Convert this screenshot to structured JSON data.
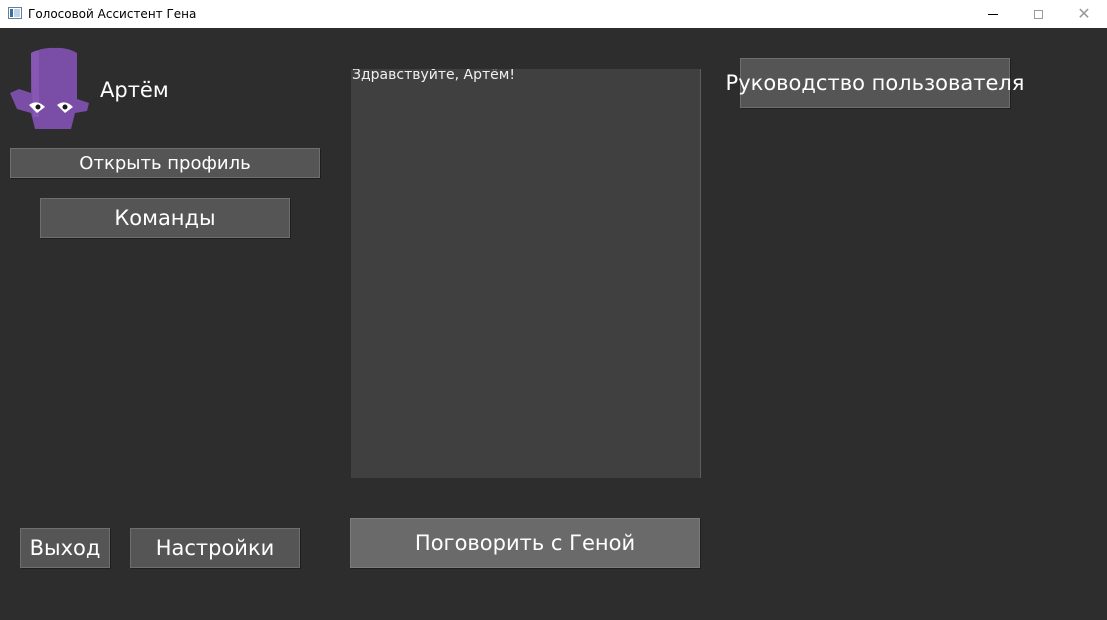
{
  "window": {
    "title": "Голосовой Ассистент Гена",
    "min_glyph": "",
    "max_glyph": "",
    "close_glyph": "✕"
  },
  "user": {
    "name": "Артём",
    "avatar_icon": "purple-mascot-icon"
  },
  "sidebar": {
    "open_profile_label": "Открыть профиль",
    "commands_label": "Команды"
  },
  "chat": {
    "messages": [
      "Здравствуйте, Артём!"
    ]
  },
  "actions": {
    "talk_label": "Поговорить с Геной",
    "manual_label": "Руководство пользователя",
    "exit_label": "Выход",
    "settings_label": "Настройки"
  },
  "colors": {
    "background": "#2d2d2d",
    "button": "#555555",
    "talk_button": "#6a6a6a",
    "chat_panel": "#404040",
    "avatar": "#7a4ea6"
  }
}
